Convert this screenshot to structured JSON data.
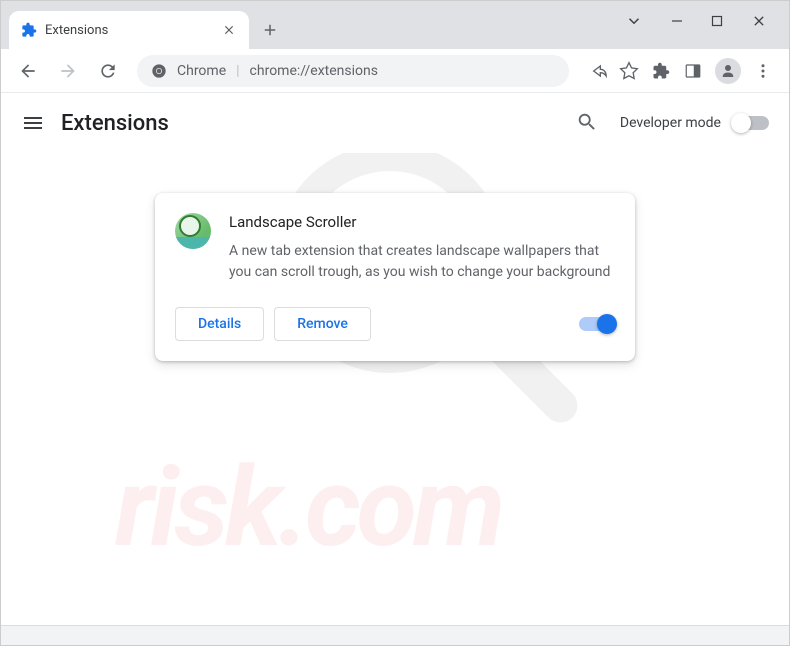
{
  "tab": {
    "title": "Extensions"
  },
  "omnibox": {
    "label": "Chrome",
    "url": "chrome://extensions"
  },
  "page": {
    "title": "Extensions",
    "dev_mode_label": "Developer mode"
  },
  "extension": {
    "name": "Landscape Scroller",
    "description": "A new tab extension that creates landscape wallpapers that you can scroll trough, as you wish to change your background",
    "details_label": "Details",
    "remove_label": "Remove",
    "enabled": true
  }
}
